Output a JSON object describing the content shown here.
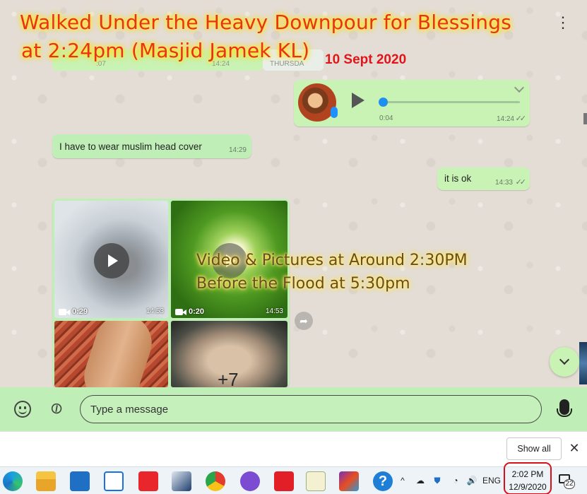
{
  "overlay": {
    "title_line1": "Walked Under the Heavy Downpour for Blessings",
    "title_line2": "at 2:24pm (Masjid Jamek KL)",
    "date": "10 Sept 2020",
    "caption_line1": "Video & Pictures at Around  2:30PM",
    "caption_line2": "Before the Flood at 5:30pm"
  },
  "partials": {
    "time_a": ":07",
    "time_b": "14:24",
    "time_c": "THURSDA"
  },
  "voice_note": {
    "duration": "0:04",
    "time": "14:24"
  },
  "messages": [
    {
      "text": "I have to wear muslim head cover",
      "time": "14:29"
    },
    {
      "text": "it is ok",
      "time": "14:33"
    }
  ],
  "media": {
    "video1_length": "0:29",
    "video1_time": "14:53",
    "video2_length": "0:20",
    "video2_time": "14:53",
    "more_count": "+7"
  },
  "composer": {
    "placeholder": "Type a message"
  },
  "download_bar": {
    "show_all": "Show all"
  },
  "taskbar": {
    "language": "ENG",
    "time": "2:02 PM",
    "date": "12/9/2020",
    "notification_count": "22"
  },
  "icons": {
    "menu": "menu-dots-icon",
    "play": "play-icon",
    "forward": "forward-icon",
    "scroll_down": "chevron-down-icon",
    "emoji": "emoji-icon",
    "attach": "paperclip-icon",
    "mic": "microphone-icon"
  },
  "colors": {
    "bubble": "#c9f2b5",
    "composer": "#bfefb6",
    "title": "#e8331c",
    "date": "#e0151b",
    "clock_highlight": "#d8101c",
    "progress": "#1e8ff0"
  }
}
